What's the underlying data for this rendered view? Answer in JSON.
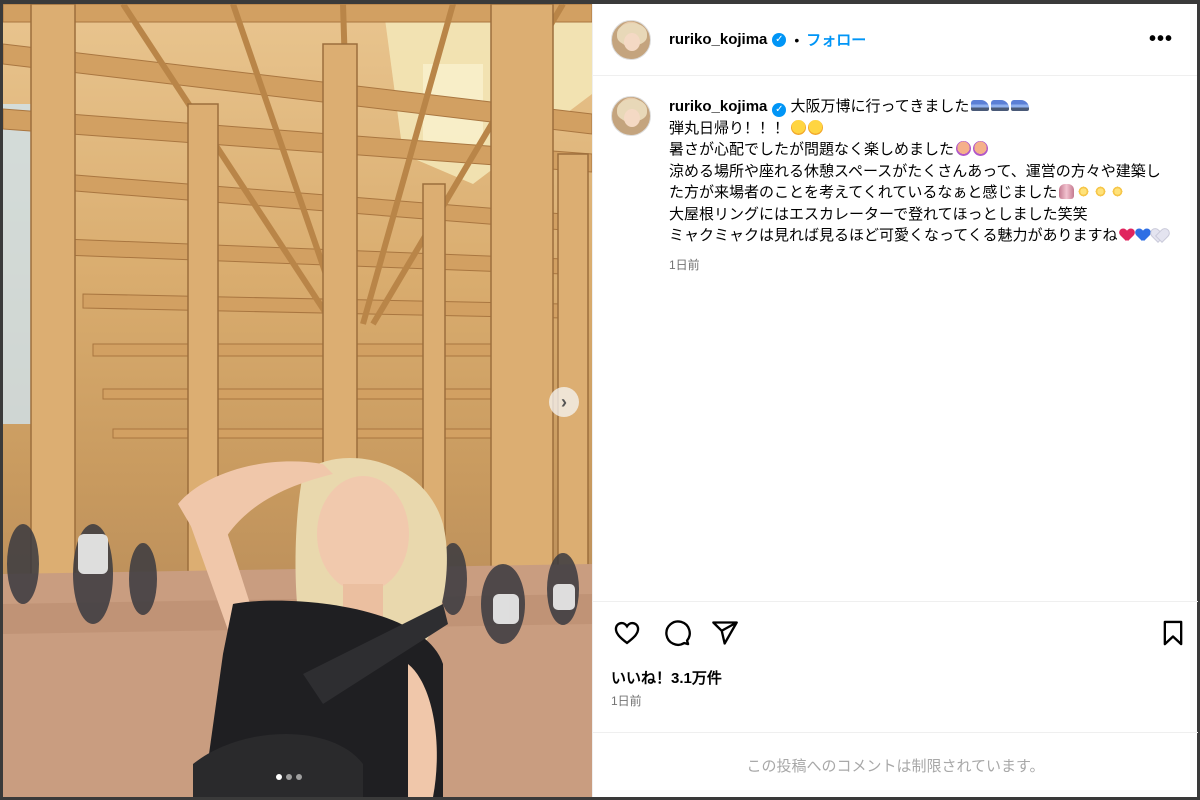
{
  "post": {
    "username": "ruriko_kojima",
    "verified": true,
    "separator": "•",
    "follow_label": "フォロー",
    "more_label": "•••",
    "caption": {
      "line1": "大阪万博に行ってきました",
      "line2": "弾丸日帰り！！！",
      "line3": "暑さが心配でしたが問題なく楽しめました",
      "line4": "涼める場所や座れる休憩スペースがたくさんあって、運営の方々や建築した方が来場者のことを考えてくれているなぁと感じました",
      "line5": "大屋根リングにはエスカレーターで登れてほっとしました笑笑",
      "line6": "ミャクミャクは見れば見るほど可愛くなってくる魅力がありますね",
      "emojis": [
        "train-icon",
        "rolling-laughing-face-icon",
        "saluting-face-icon",
        "praying-hands-icon",
        "sparkles-icon",
        "red-heart-icon",
        "blue-heart-icon",
        "white-heart-icon"
      ]
    },
    "caption_time": "1日前",
    "likes": "いいね！3.1万件",
    "post_time": "1日前",
    "comments_restricted": "この投稿へのコメントは制限されています。",
    "carousel": {
      "total": 3,
      "current": 1
    },
    "icons": [
      "heart-icon",
      "comment-icon",
      "share-icon",
      "bookmark-icon",
      "chevron-right-icon"
    ]
  },
  "colors": {
    "link": "#0095f6",
    "secondary": "#737373",
    "restricted": "#a8a8a8"
  }
}
